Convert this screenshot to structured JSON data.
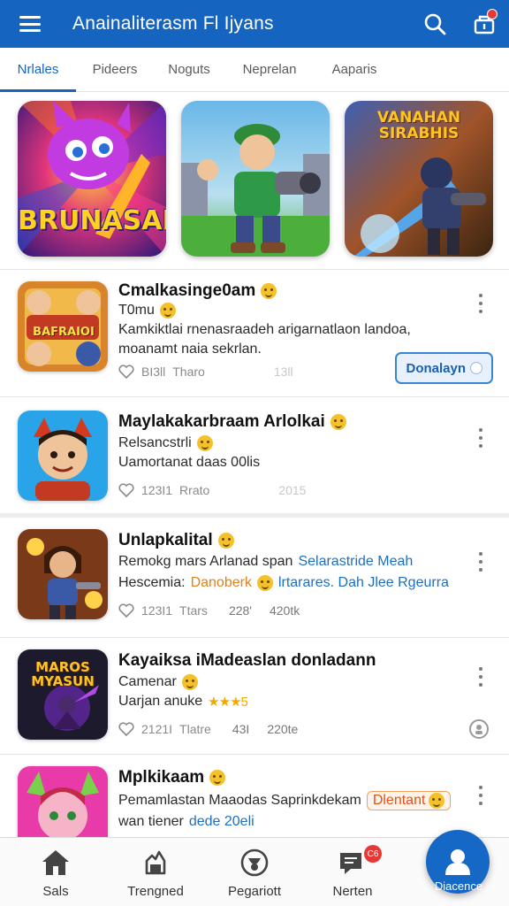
{
  "appbar": {
    "title": "Anainaliterasm Fl Ijyans",
    "menu_icon": "menu-icon",
    "search_icon": "search-icon",
    "notification_icon": "notification-icon",
    "bg_color": "#1565c0"
  },
  "tabs": [
    {
      "label": "Nrlales",
      "active": true
    },
    {
      "label": "Pideers",
      "active": false
    },
    {
      "label": "Noguts",
      "active": false
    },
    {
      "label": "Neprelan",
      "active": false
    },
    {
      "label": "Aaparis",
      "active": false
    }
  ],
  "featured": [
    {
      "title": "BRUNASAI"
    },
    {
      "title": ""
    },
    {
      "title_line1": "VANAHAN",
      "title_line2": "SIRABHIS"
    }
  ],
  "items": [
    {
      "title": "Cmalkasinge0am",
      "subtitle": "T0mu",
      "desc_line1": "Kamkiktlai rnenasraadeh arigarnatlaon landoa,",
      "desc_line2": "moanamt naia sekrlan.",
      "likes": "BI3ll",
      "label": "Tharo",
      "count": "13ll",
      "action_label": "Donalayn",
      "thumb_text": "BAFRAIOI"
    },
    {
      "title": "Maylakakarbraam Arlolkai",
      "subtitle": "Relsancstrli",
      "desc_line1": "Uamortanat daas 00lis",
      "likes": "123I1",
      "label": "Rrato",
      "count": "2015"
    },
    {
      "title": "Unlapkalital",
      "subtitle_prefix": "Remokg mars Arlanad span",
      "subtitle_highlight": "Selarastride Meah",
      "desc_prefix": "Hescemia:",
      "desc_orange": "Danoberk",
      "desc_highlight": "lrtarares. Dah Jlee Rgeurra",
      "likes": "123I1",
      "label": "Ttars",
      "extra": "228'",
      "count": "420tk"
    },
    {
      "title": "Kayaiksa iMadeaslan donladann",
      "subtitle": "Camenar",
      "desc_line1": "Uarjan anuke",
      "stars": "★★★5",
      "likes": "2121I",
      "label": "Tlatre",
      "extra": "43I",
      "count": "220te",
      "thumb_text": "MAROS MYASUN"
    },
    {
      "title": "Mplkikaam",
      "subtitle": "Pemamlastan Maaodas Saprinkdekam",
      "chip_label": "Dlentant",
      "desc_prefix": "wan tiener",
      "desc_highlight": "dede 20eli"
    }
  ],
  "bottom_nav": [
    {
      "label": "Sals",
      "icon": "home-icon"
    },
    {
      "label": "Trengned",
      "icon": "trending-icon"
    },
    {
      "label": "Pegariott",
      "icon": "pegariott-icon"
    },
    {
      "label": "Nerten",
      "icon": "chat-icon",
      "badge": "C6"
    },
    {
      "label": "Diacence",
      "icon": "profile-icon",
      "active": true
    }
  ]
}
